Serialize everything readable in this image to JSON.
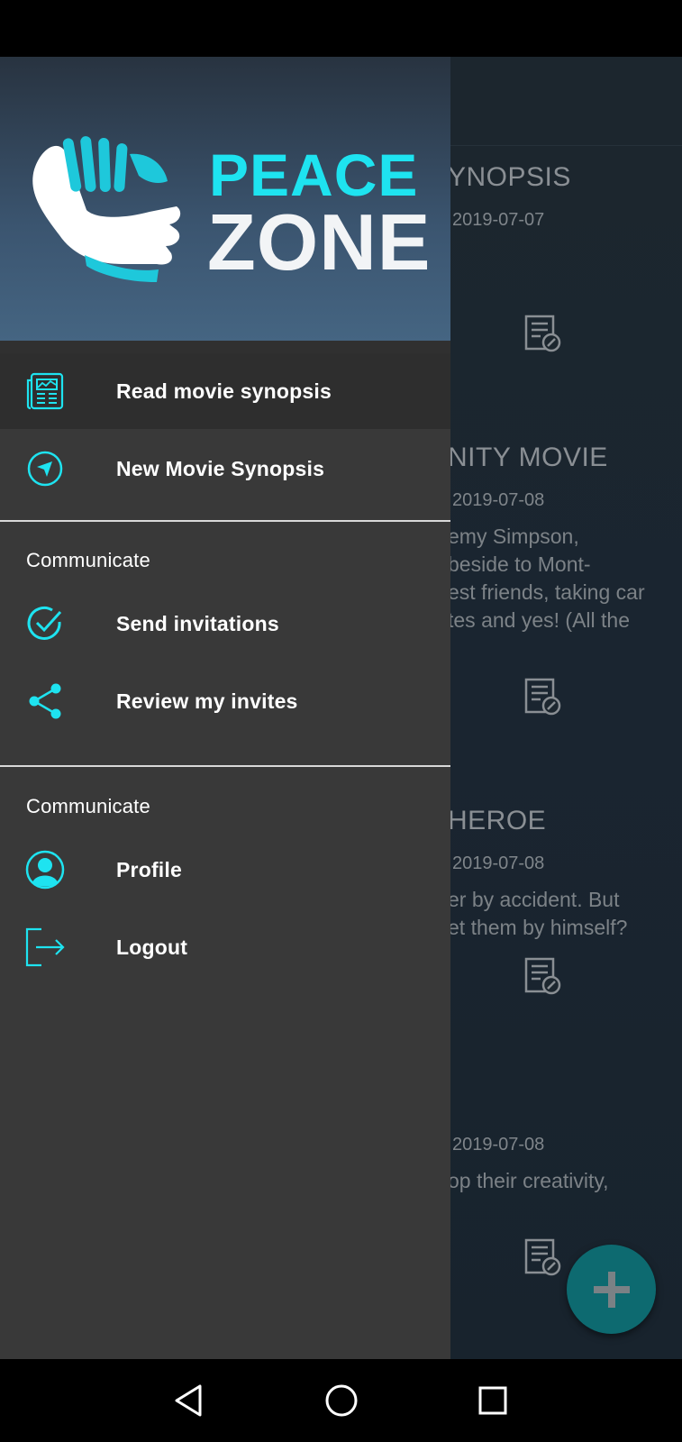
{
  "app": {
    "name": "Peace Zone",
    "logo_line1": "PEACE",
    "logo_line2": "ZONE"
  },
  "colors": {
    "accent": "#1ee3f0",
    "drawer_bg": "#393939",
    "selected_bg": "#2e2e2e"
  },
  "drawer": {
    "items_primary": [
      {
        "label": "Read movie synopsis",
        "icon": "newspaper-icon",
        "selected": true
      },
      {
        "label": "New Movie Synopsis",
        "icon": "navigation-icon",
        "selected": false
      }
    ],
    "section1": {
      "title": "Communicate",
      "items": [
        {
          "label": "Send invitations",
          "icon": "check-circle-icon"
        },
        {
          "label": "Review my invites",
          "icon": "share-icon"
        }
      ]
    },
    "section2": {
      "title": "Communicate",
      "items": [
        {
          "label": "Profile",
          "icon": "profile-icon"
        },
        {
          "label": "Logout",
          "icon": "logout-icon"
        }
      ]
    }
  },
  "background_cards": [
    {
      "title": "YNOPSIS",
      "date": "2019-07-07",
      "text": ""
    },
    {
      "title": "NITY MOVIE",
      "date": "2019-07-08",
      "text": "emy Simpson,\nbeside to Mont-\nest friends, taking car\ntes and yes! (All the"
    },
    {
      "title": "HEROE",
      "date": "2019-07-08",
      "text": "er by accident. But\net them by himself?"
    },
    {
      "title": "",
      "date": "2019-07-08",
      "text": "op their creativity,"
    }
  ],
  "fab": {
    "icon": "plus-icon"
  },
  "navbar": {
    "back": "back-icon",
    "home": "home-icon",
    "recents": "recents-icon"
  }
}
